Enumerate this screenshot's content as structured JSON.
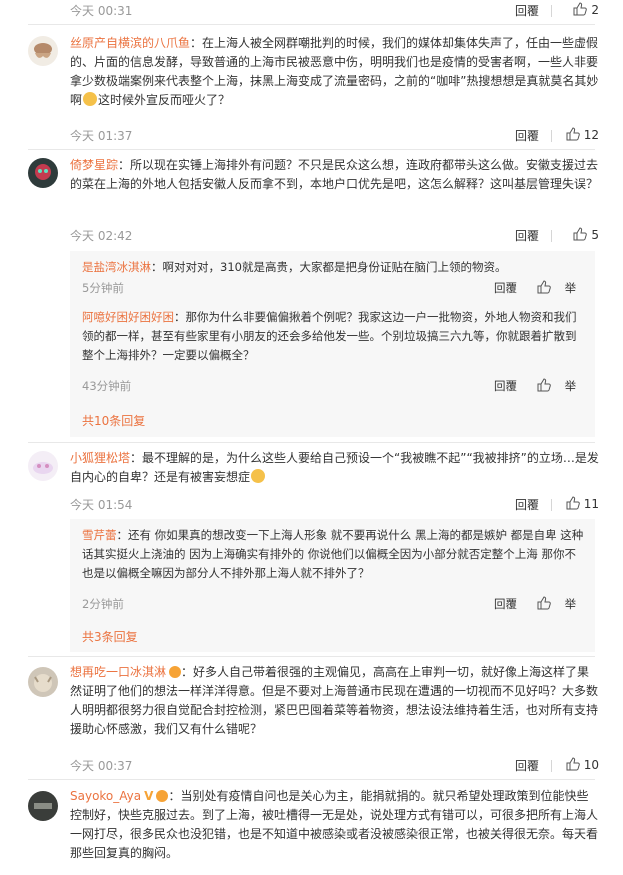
{
  "labels": {
    "reply": "回覆",
    "more_suffix": "条回复",
    "report": "举"
  },
  "colors": {
    "username": "#eb7340",
    "meta": "#999999",
    "sub_bg": "#f7f7f7"
  },
  "icons": [
    "thumb-up-icon",
    "report-icon",
    "smiley-emoji",
    "vip-crown-icon",
    "fire-badge-icon"
  ],
  "comments": [
    {
      "time": "今天 00:31",
      "likes": "2"
    },
    {
      "user": "丝原产自横滨的八爪鱼",
      "text_a": "：在上海人被全网群嘲批判的时候，我们的媒体却集体失声了，任由一些虚假的、片面的信息发酵，导致普通的上海市民被恶意中伤，明明我们也是疫情的受害者啊，一些人非要拿少数极端案例来代表整个上海，抹黑上海变成了流量密码，之前的“咖啡”热搜想想是真就莫名其妙啊",
      "text_b": "这时候外宣反而哑火了？",
      "time": "今天 01:37",
      "likes": "12"
    },
    {
      "user": "倚梦星踪",
      "text": "：所以现在实锤上海排外有问题？不只是民众这么想，连政府都带头这么做。安徽支援过去的菜在上海的外地人包括安徽人反而拿不到，本地户口优先是吧，这怎么解释？这叫基层管理失误？",
      "time": "今天 02:42",
      "likes": "5",
      "replies": [
        {
          "user": "是盐湾冰淇淋",
          "text": "：啊对对对，310就是高贵，大家都是把身份证贴在脑门上领的物资。",
          "time": "5分钟前"
        },
        {
          "user": "阿噫好困好困好困",
          "text": "：那你为什么非要偏偏揪着个例呢？我家这边一户一批物资，外地人物资和我们领的都一样，甚至有些家里有小朋友的还会多给他发一些。个别垃圾搞三六九等，你就跟着扩散到整个上海排外？一定要以偏概全？",
          "time": "43分钟前"
        }
      ],
      "more_count": "共10"
    },
    {
      "user": "小狐狸松塔",
      "text_a": "：最不理解的是，为什么这些人要给自己预设一个“我被瞧不起”“我被排挤”的立场…是发自内心的自卑？还是有被害妄想症",
      "time": "今天 01:54",
      "likes": "11",
      "replies": [
        {
          "user": "雪芹蕾",
          "text": "：还有 你如果真的想改变一下上海人形象 就不要再说什么 黑上海的都是嫉妒 都是自卑 这种话其实挺火上浇油的 因为上海确实有排外的 你说他们以偏概全因为小部分就否定整个上海 那你不也是以偏概全嘛因为部分人不排外那上海人就不排外了？",
          "time": "2分钟前"
        }
      ],
      "more_count": "共3"
    },
    {
      "user": "想再吃一口冰淇淋",
      "text": "：好多人自己带着很强的主观偏见，高高在上审判一切，就好像上海这样了果然证明了他们的想法一样洋洋得意。但是不要对上海普通市民现在遭遇的一切视而不见好吗？大多数人明明都很努力很自觉配合封控检测，紧巴巴囤着菜等着物资，想法设法维持着生活，也对所有支持援助心怀感激，我们又有什么错呢？",
      "time": "今天 00:37",
      "likes": "10"
    },
    {
      "user": "Sayoko_Aya",
      "text": "：当别处有疫情自问也是关心为主，能捐就捐的。就只希望处理政策到位能快些控制好，快些克服过去。到了上海，被吐槽得一无是处，说处理方式有错可以，可很多把所有上海人一网打尽，很多民众也没犯错，也是不知道中被感染或者没被感染很正常，也被关得很无奈。每天看那些回复真的胸闷。"
    }
  ]
}
